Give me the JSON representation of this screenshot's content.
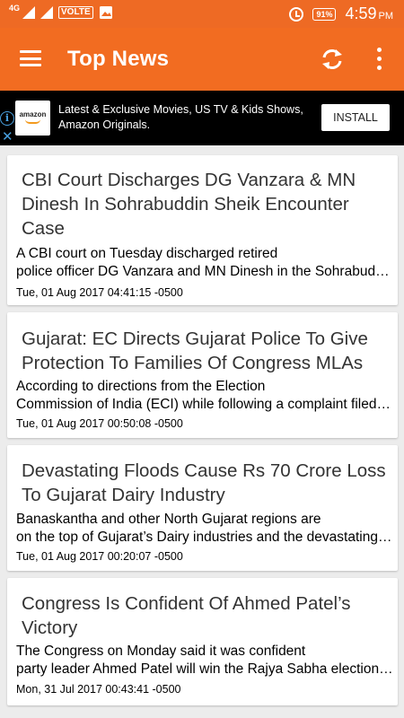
{
  "status_bar": {
    "network": "4G",
    "volte": "VOLTE",
    "battery": "91%",
    "time": "4:59",
    "ampm": "PM"
  },
  "app_bar": {
    "title": "Top News"
  },
  "ad": {
    "logo": "amazon",
    "text": "Latest & Exclusive Movies, US TV & Kids Shows, Amazon Originals.",
    "cta": "INSTALL"
  },
  "articles": [
    {
      "title": "CBI Court Discharges DG Vanzara & MN Dinesh In Sohrabuddin Sheik Encounter Case",
      "desc_line1": "A CBI court on Tuesday discharged retired",
      "desc_line2": "police officer DG Vanzara and MN Dinesh in the Sohrabuddin Sheik encounter case",
      "date": "Tue, 01 Aug 2017 04:41:15 -0500"
    },
    {
      "title": "Gujarat: EC Directs Gujarat Police To Give Protection To Families Of Congress MLAs",
      "desc_line1": "According to directions from the Election",
      "desc_line2": "Commission of India (ECI) while following a complaint filed by the Congress",
      "date": "Tue, 01 Aug 2017 00:50:08 -0500"
    },
    {
      "title": "Devastating Floods Cause Rs 70 Crore Loss To Gujarat Dairy Industry",
      "desc_line1": "Banaskantha and other North Gujarat regions are",
      "desc_line2": "on the top of Gujarat’s Dairy industries and the devastating floods",
      "date": "Tue, 01 Aug 2017 00:20:07 -0500"
    },
    {
      "title": "Congress Is Confident Of Ahmed Patel’s Victory",
      "desc_line1": "The Congress on Monday said it was confident",
      "desc_line2": "party leader Ahmed Patel will win the Rajya Sabha election from Gujarat",
      "date": "Mon, 31 Jul 2017 00:43:41 -0500"
    }
  ],
  "colors": {
    "status_bar": "#ee6a24",
    "app_bar": "#f26c21",
    "ad_background": "#000000",
    "feed_background": "#ececec"
  }
}
